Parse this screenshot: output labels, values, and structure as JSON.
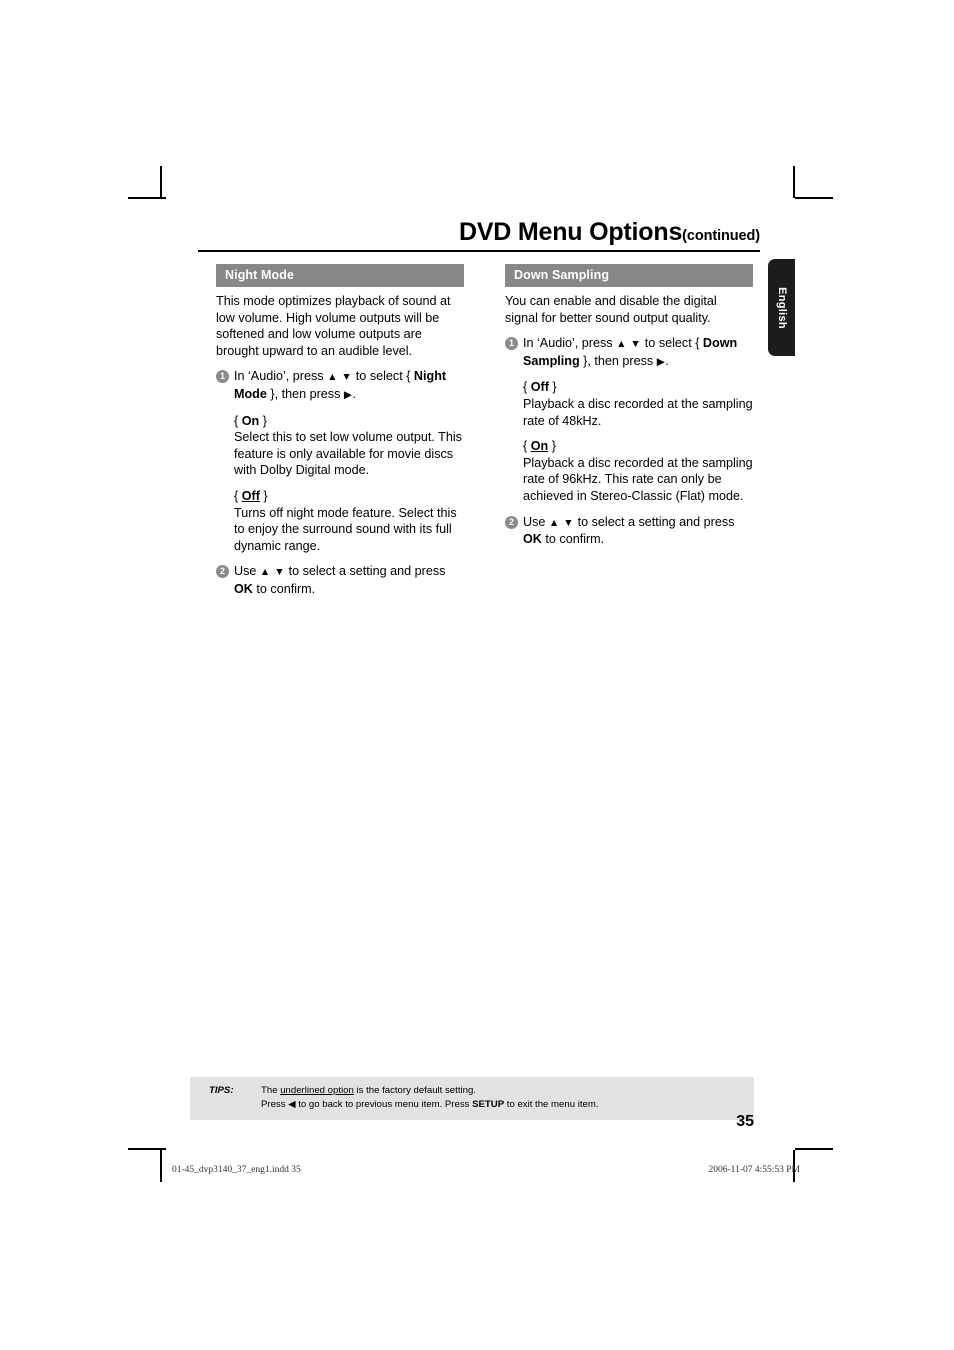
{
  "header": {
    "title": "DVD Menu Options",
    "continued": "(continued)"
  },
  "language_tab": {
    "label": "English"
  },
  "columns": [
    {
      "id": "night-mode",
      "heading": "Night Mode",
      "intro": "This mode optimizes playback of sound at low volume. High volume outputs will be softened and low volume outputs are brought upward to an audible level.",
      "steps": [
        {
          "number": "1",
          "text_before": "In ‘Audio’, press ",
          "arrows": "▲ ▼",
          "text_mid": " to select { ",
          "bold": "Night Mode",
          "text_after": " }, then press ",
          "arrow_right": "▶",
          "text_end": "."
        }
      ],
      "options": [
        {
          "open": "{ ",
          "name": "On",
          "close": " }",
          "underlined": false,
          "desc": "Select this to set low volume output. This feature is only available for movie discs with Dolby Digital mode."
        },
        {
          "open": "{ ",
          "name": "Off",
          "close": " }",
          "underlined": true,
          "desc": "Turns off night mode feature. Select this to enjoy the surround sound with its full dynamic range."
        }
      ],
      "final_step": {
        "number": "2",
        "text_before": "Use ",
        "arrows": "▲ ▼",
        "text_mid": " to select a setting and press ",
        "bold": "OK",
        "text_after": " to confirm."
      }
    },
    {
      "id": "down-sampling",
      "heading": "Down Sampling",
      "intro": "You can enable and disable the digital signal for better sound output quality.",
      "steps": [
        {
          "number": "1",
          "text_before": "In ‘Audio’, press ",
          "arrows": "▲ ▼",
          "text_mid": " to select { ",
          "bold": "Down Sampling",
          "text_after": " }, then press ",
          "arrow_right": "▶",
          "text_end": "."
        }
      ],
      "options": [
        {
          "open": "{ ",
          "name": "Off",
          "close": " }",
          "underlined": false,
          "desc": "Playback a disc recorded at the sampling rate of 48kHz."
        },
        {
          "open": "{ ",
          "name": "On",
          "close": " }",
          "underlined": true,
          "desc": "Playback a disc recorded at the sampling rate of 96kHz. This rate can only be achieved in Stereo-Classic (Flat) mode."
        }
      ],
      "final_step": {
        "number": "2",
        "text_before": "Use ",
        "arrows": "▲ ▼",
        "text_mid": " to select a setting and press ",
        "bold": "OK",
        "text_after": " to confirm."
      }
    }
  ],
  "tips": {
    "label": "TIPS:",
    "line1_before": "The ",
    "line1_underlined": "underlined option",
    "line1_after": " is the factory default setting.",
    "line2_before": "Press ",
    "line2_arrow": "◀",
    "line2_mid": " to go back to previous menu item. Press ",
    "line2_bold": "SETUP",
    "line2_after": " to exit the menu item."
  },
  "page_number": "35",
  "slug": {
    "left": "01-45_dvp3140_37_eng1.indd   35",
    "right": "2006-11-07   4:55:53 PM"
  }
}
